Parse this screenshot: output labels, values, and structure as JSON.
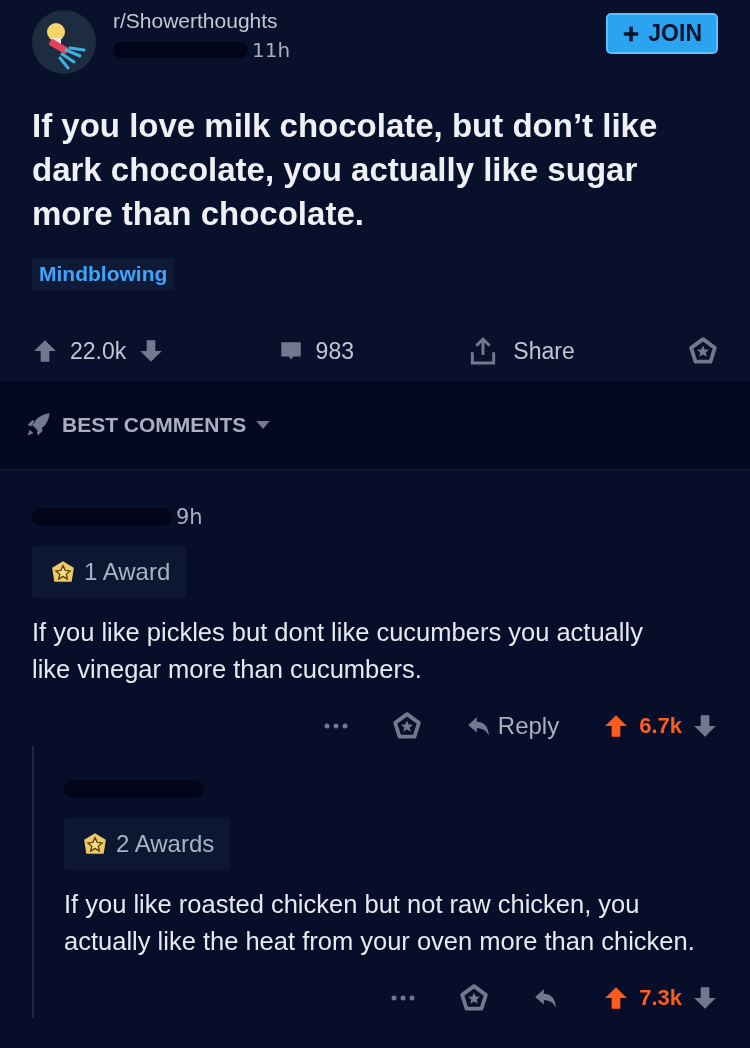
{
  "post": {
    "subreddit": "r/Showerthoughts",
    "age": "11h",
    "join_label": "JOIN",
    "title": "If you love milk chocolate, but don’t like dark chocolate, you actually like sugar more than chocolate.",
    "flair": "Mindblowing",
    "score": "22.0k",
    "upvoted": false,
    "comments_count": "983",
    "share_label": "Share"
  },
  "sort": {
    "label": "BEST COMMENTS"
  },
  "comments": [
    {
      "age": "9h",
      "awards": "1 Award",
      "body": "If you like pickles but dont like cucumbers you actually like vinegar more than cucumbers.",
      "reply_label": "Reply",
      "score": "6.7k",
      "upvoted": true,
      "nested": false
    },
    {
      "awards": "2 Awards",
      "body": "If you like roasted chicken but not raw chicken, you actually like the heat from your oven more than chicken.",
      "score": "7.3k",
      "upvoted": true,
      "nested": true
    }
  ]
}
